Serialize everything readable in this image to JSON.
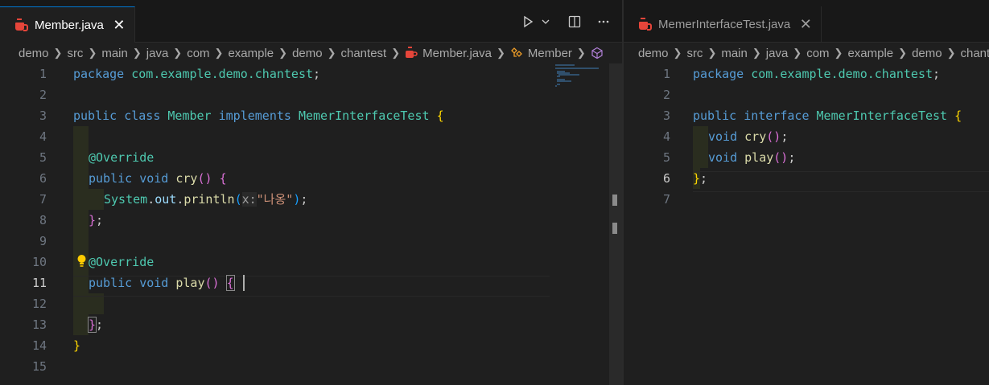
{
  "left": {
    "tab": {
      "title": "Member.java",
      "close": "✕"
    },
    "breadcrumb": [
      "demo",
      "src",
      "main",
      "java",
      "com",
      "example",
      "demo",
      "chantest",
      "Member.java",
      "Member"
    ],
    "toolbar": {
      "run": "run-icon",
      "split": "split-editor-icon",
      "more": "more-actions-icon"
    }
  },
  "right": {
    "tab": {
      "title": "MemerInterfaceTest.java",
      "close": "✕"
    },
    "breadcrumb": [
      "demo",
      "src",
      "main",
      "java",
      "com",
      "example",
      "demo",
      "chant"
    ]
  },
  "colors": {
    "keyword": "#569cd6",
    "type": "#4ec9b0",
    "function": "#dcdcaa",
    "string": "#ce9178",
    "bracket_gold": "#ffd700",
    "bracket_pink": "#da70d6",
    "bracket_blue": "#179fff",
    "accent": "#0078d4"
  },
  "code_left": {
    "line_numbers": [
      "1",
      "2",
      "3",
      "4",
      "5",
      "6",
      "7",
      "8",
      "9",
      "10",
      "11",
      "12",
      "13",
      "14",
      "15"
    ],
    "l1": {
      "kw": "package",
      "pkg": "com.example.demo.chantest",
      "semi": ";"
    },
    "l3": {
      "public": "public",
      "class": "class",
      "name": "Member",
      "implements": "implements",
      "iface": "MemerInterfaceTest",
      "brace": "{"
    },
    "l5": {
      "annotation": "@Override"
    },
    "l6": {
      "public": "public",
      "void": "void",
      "method": "cry",
      "parens": "()",
      "brace": "{"
    },
    "l7": {
      "sys": "System",
      "dot1": ".",
      "out": "out",
      "dot2": ".",
      "println": "println",
      "open": "(",
      "hint": "x:",
      "str": "\"나옹\"",
      "close": ")",
      "semi": ";"
    },
    "l8": {
      "brace": "}",
      "semi": ";"
    },
    "l10": {
      "annotation": "@Override"
    },
    "l11": {
      "public": "public",
      "void": "void",
      "method": "play",
      "parens": "()",
      "brace": "{"
    },
    "l13": {
      "brace": "}",
      "semi": ";"
    },
    "l14": {
      "brace": "}"
    }
  },
  "code_right": {
    "line_numbers": [
      "1",
      "2",
      "3",
      "4",
      "5",
      "6",
      "7"
    ],
    "l1": {
      "kw": "package",
      "pkg": "com.example.demo.chantest",
      "semi": ";"
    },
    "l3": {
      "public": "public",
      "interface": "interface",
      "name": "MemerInterfaceTest",
      "brace": "{"
    },
    "l4": {
      "void": "void",
      "method": "cry",
      "parens": "()",
      "semi": ";"
    },
    "l5": {
      "void": "void",
      "method": "play",
      "parens": "()",
      "semi": ";"
    },
    "l6": {
      "brace": "}",
      "semi": ";"
    }
  }
}
